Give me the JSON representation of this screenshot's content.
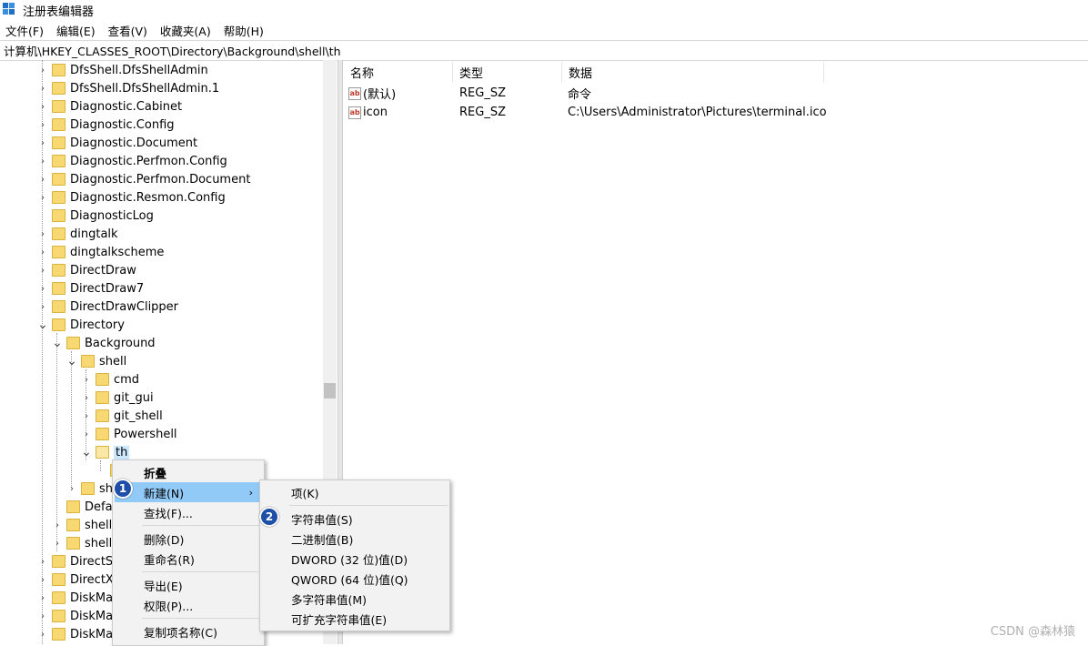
{
  "window": {
    "title": "注册表编辑器"
  },
  "menubar": [
    "文件(F)",
    "编辑(E)",
    "查看(V)",
    "收藏夹(A)",
    "帮助(H)"
  ],
  "address": "计算机\\HKEY_CLASSES_ROOT\\Directory\\Background\\shell\\th",
  "tree": [
    {
      "label": "DfsShell.DfsShellAdmin",
      "arrow": ">"
    },
    {
      "label": "DfsShell.DfsShellAdmin.1",
      "arrow": ">"
    },
    {
      "label": "Diagnostic.Cabinet",
      "arrow": ">"
    },
    {
      "label": "Diagnostic.Config",
      "arrow": ">"
    },
    {
      "label": "Diagnostic.Document",
      "arrow": ">"
    },
    {
      "label": "Diagnostic.Perfmon.Config",
      "arrow": ">"
    },
    {
      "label": "Diagnostic.Perfmon.Document",
      "arrow": ">"
    },
    {
      "label": "Diagnostic.Resmon.Config",
      "arrow": ">"
    },
    {
      "label": "DiagnosticLog",
      "arrow": ""
    },
    {
      "label": "dingtalk",
      "arrow": ">"
    },
    {
      "label": "dingtalkscheme",
      "arrow": ">"
    },
    {
      "label": "DirectDraw",
      "arrow": ">"
    },
    {
      "label": "DirectDraw7",
      "arrow": ">"
    },
    {
      "label": "DirectDrawClipper",
      "arrow": ">"
    },
    {
      "label": "Directory",
      "arrow": "v"
    },
    {
      "label": "Background",
      "arrow": "v"
    },
    {
      "label": "shell",
      "arrow": "v"
    },
    {
      "label": "cmd",
      "arrow": ">"
    },
    {
      "label": "git_gui",
      "arrow": ">"
    },
    {
      "label": "git_shell",
      "arrow": ">"
    },
    {
      "label": "Powershell",
      "arrow": ">"
    },
    {
      "label": "th",
      "arrow": "v"
    },
    {
      "label": "",
      "arrow": ""
    },
    {
      "label": "she",
      "arrow": ">"
    },
    {
      "label": "Defau",
      "arrow": ""
    },
    {
      "label": "shell",
      "arrow": ">"
    },
    {
      "label": "shelle",
      "arrow": ">"
    },
    {
      "label": "DirectSh",
      "arrow": ">"
    },
    {
      "label": "DirectXF",
      "arrow": ">"
    },
    {
      "label": "DiskMar",
      "arrow": ">"
    },
    {
      "label": "DiskMar",
      "arrow": ">"
    },
    {
      "label": "DiskMar",
      "arrow": ">"
    }
  ],
  "list": {
    "headers": [
      "名称",
      "类型",
      "数据"
    ],
    "rows": [
      {
        "name": "(默认)",
        "type": "REG_SZ",
        "data": "命令",
        "icon": "ab-string-icon"
      },
      {
        "name": "icon",
        "type": "REG_SZ",
        "data": "C:\\Users\\Administrator\\Pictures\\terminal.ico",
        "icon": "ab-string-icon"
      }
    ]
  },
  "context_menu": {
    "items": [
      "折叠",
      "新建(N)",
      "查找(F)...",
      "删除(D)",
      "重命名(R)",
      "导出(E)",
      "权限(P)...",
      "复制项名称(C)"
    ],
    "highlighted": "新建(N)"
  },
  "submenu": {
    "items": [
      "项(K)",
      "字符串值(S)",
      "二进制值(B)",
      "DWORD (32 位)值(D)",
      "QWORD (64 位)值(Q)",
      "多字符串值(M)",
      "可扩充字符串值(E)"
    ]
  },
  "badges": [
    "1",
    "2"
  ],
  "watermark": "CSDN @森林猿"
}
